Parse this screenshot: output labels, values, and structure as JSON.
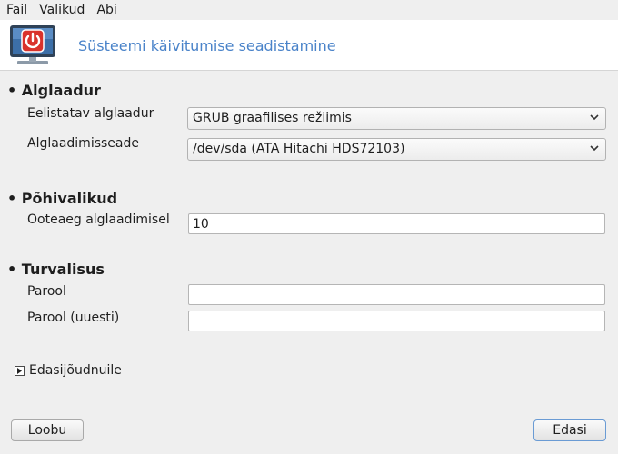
{
  "menubar": {
    "items": [
      {
        "mnemonic": "F",
        "rest": "ail"
      },
      {
        "pre": "Val",
        "mnemonic": "i",
        "rest": "kud"
      },
      {
        "mnemonic": "A",
        "rest": "bi"
      }
    ]
  },
  "banner": {
    "title": "Süsteemi käivitumise seadistamine",
    "icon": "power-monitor-icon"
  },
  "sections": {
    "bootloader": {
      "title": "• Alglaadur",
      "default_label": "Eelistatav alglaadur",
      "default_value": "GRUB graafilises režiimis",
      "device_label": "Alglaadimisseade",
      "device_value": "/dev/sda (ATA Hitachi HDS72103)"
    },
    "main": {
      "title": "• Põhivalikud",
      "timeout_label": "Ooteaeg alglaadimisel",
      "timeout_value": "10"
    },
    "security": {
      "title": "• Turvalisus",
      "password_label": "Parool",
      "password_value": "",
      "password_again_label": "Parool (uuesti)",
      "password_again_value": ""
    }
  },
  "advanced": {
    "label": "Edasijõudnuile",
    "expanded": false
  },
  "buttons": {
    "cancel": "Loobu",
    "next": "Edasi"
  },
  "colors": {
    "accent": "#4a83c9",
    "icon_red": "#d9322b",
    "background": "#efefef"
  }
}
